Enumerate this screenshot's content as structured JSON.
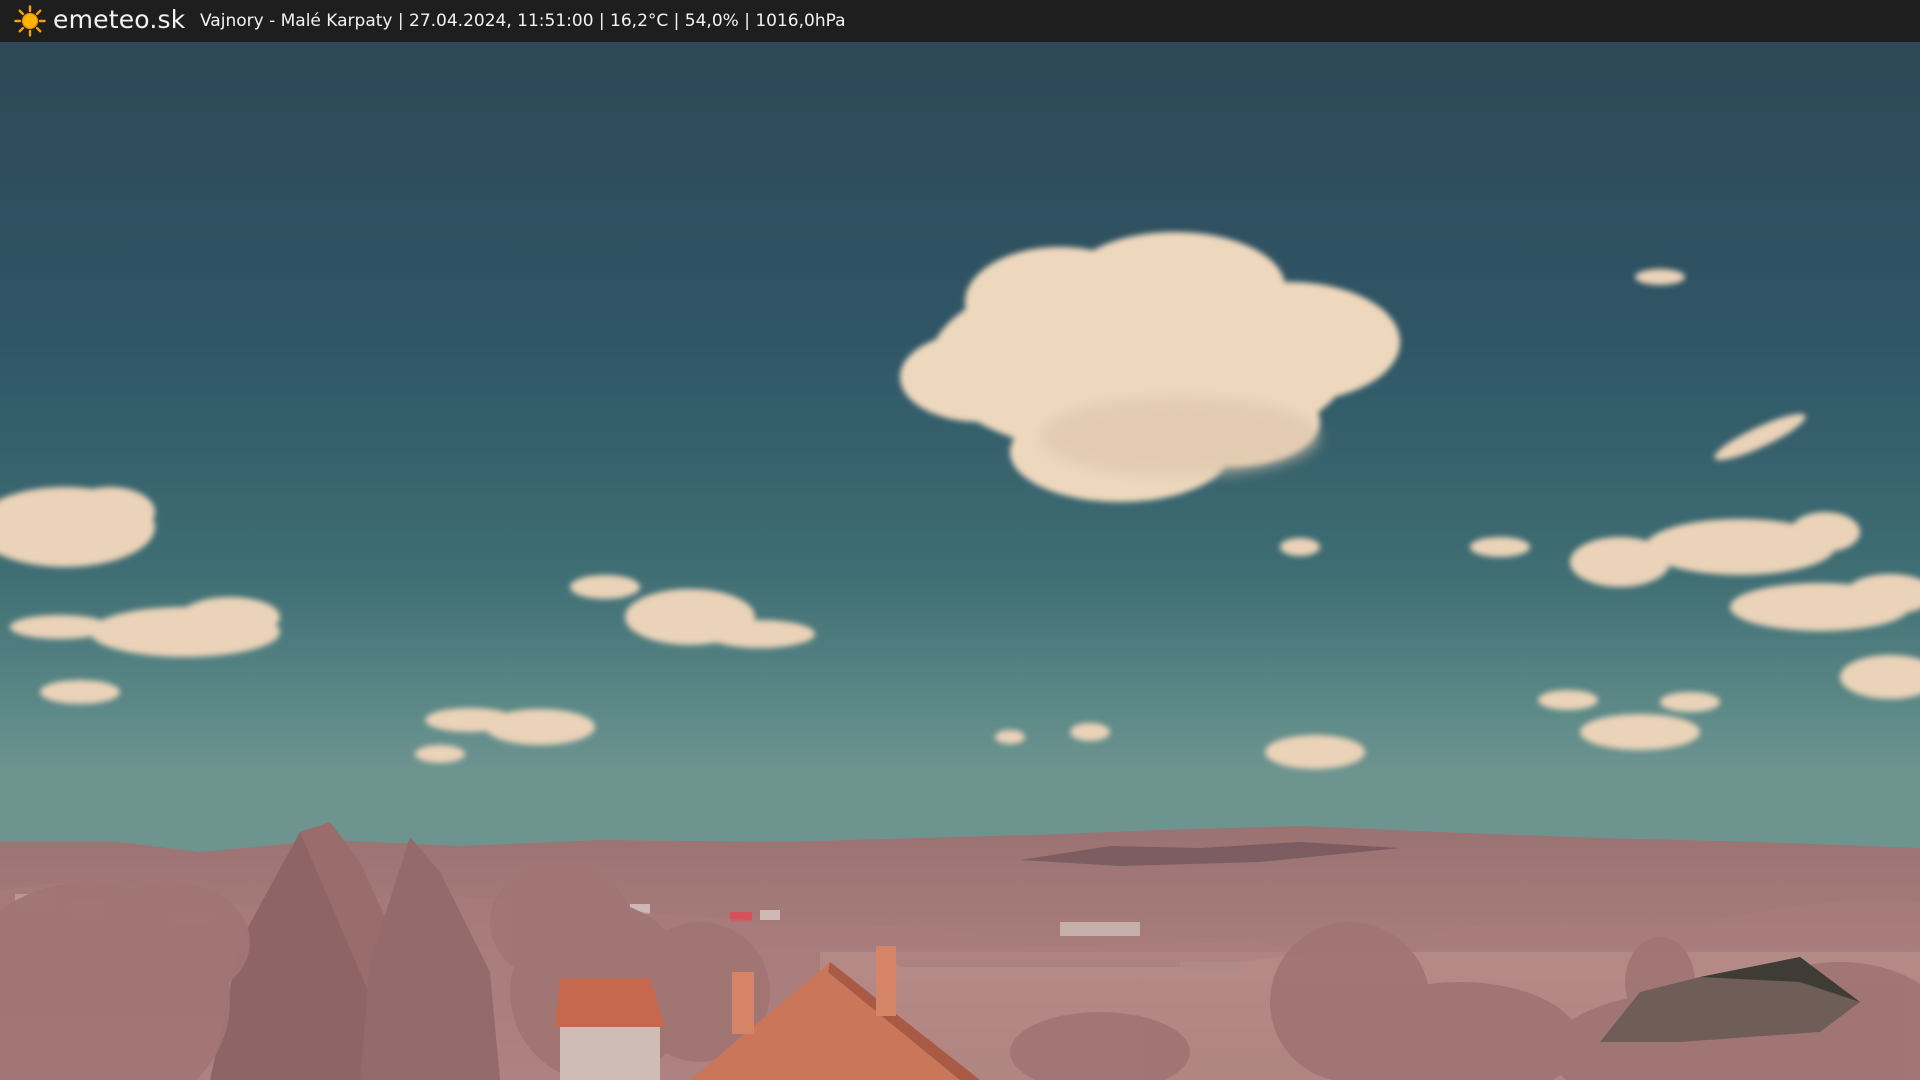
{
  "header": {
    "brand": "emeteo.sk",
    "logo_icon": "sun-icon",
    "caption": "Vajnory - Malé Karpaty | 27.04.2024, 11:51:00 | 16,2°C | 54,0% | 1016,0hPa"
  },
  "colors": {
    "topbar": "#1e1e1e",
    "sky_top": "#2f4a5a",
    "sky_bottom": "#5d8a8a",
    "cloud": "#f2dcc0",
    "hills": "#a07878",
    "vegetation": "#b08080",
    "roof": "#c46a50"
  }
}
